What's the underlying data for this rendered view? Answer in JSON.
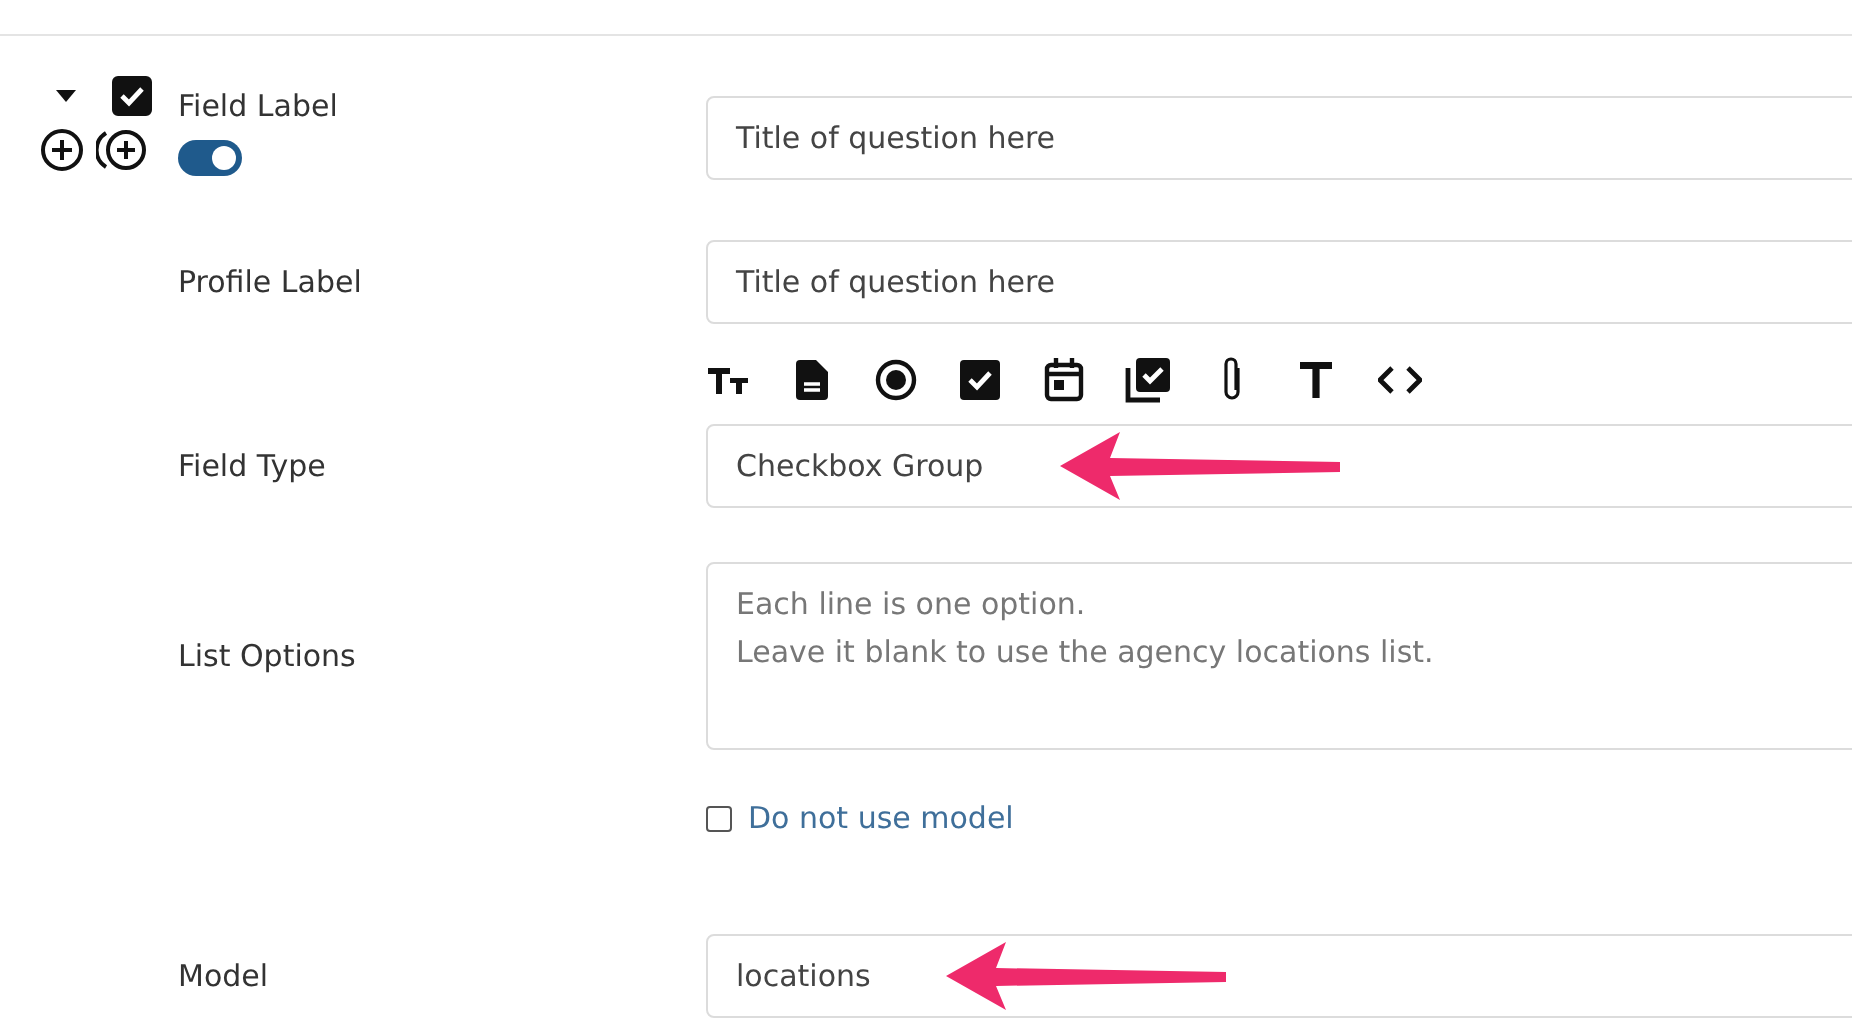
{
  "field": {
    "expanded": true,
    "checked": true,
    "toggle_on": true
  },
  "rows": [
    {
      "label": "Field Label",
      "kind": "input",
      "value": "Title of question here",
      "arrow": false
    },
    {
      "label": "Profile Label",
      "kind": "input",
      "value": "Title of question here",
      "arrow": false
    },
    {
      "label": "Field Type",
      "kind": "type",
      "value": "Checkbox Group",
      "arrow": true
    },
    {
      "label": "List Options",
      "kind": "textarea",
      "placeholder": "Each line is one option.\nLeave it blank to use the agency locations list."
    },
    {
      "kind": "check",
      "text": "Do not use model",
      "checked": false
    },
    {
      "label": "Model",
      "kind": "input",
      "value": "locations",
      "arrow": true
    }
  ]
}
